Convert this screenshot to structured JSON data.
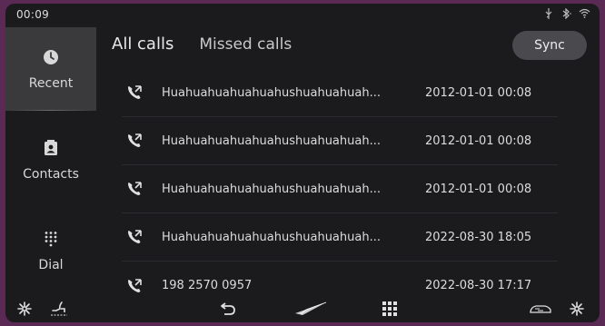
{
  "status": {
    "time": "00:09",
    "icons": [
      "usb-icon",
      "bluetooth-icon",
      "wifi-icon"
    ]
  },
  "sidebar": {
    "items": [
      {
        "label": "Recent",
        "icon": "clock-icon",
        "active": true
      },
      {
        "label": "Contacts",
        "icon": "contact-card-icon",
        "active": false
      },
      {
        "label": "Dial",
        "icon": "dialpad-icon",
        "active": false
      }
    ]
  },
  "tabs": [
    {
      "label": "All calls",
      "active": true
    },
    {
      "label": "Missed calls",
      "active": false
    }
  ],
  "sync_label": "Sync",
  "calls": [
    {
      "name": "Huahuahuahuahuahushuahuahuah...",
      "time": "2012-01-01 00:08"
    },
    {
      "name": "Huahuahuahuahuahushuahuahuah...",
      "time": "2012-01-01 00:08"
    },
    {
      "name": "Huahuahuahuahuahushuahuahuah...",
      "time": "2012-01-01 00:08"
    },
    {
      "name": "Huahuahuahuahuahushuahuahuah...",
      "time": "2022-08-30 18:05"
    },
    {
      "name": "198 2570 0957",
      "time": "2022-08-30 17:17"
    }
  ],
  "bottom": {
    "icons": [
      "fan-icon",
      "seat-heat-icon",
      "back-icon",
      "brand-logo-icon",
      "apps-grid-icon",
      "car-air-icon",
      "fan-icon"
    ]
  },
  "colors": {
    "background": "#1b1b1d",
    "active_item": "#3a3a3d",
    "button": "#4a4a4e",
    "border": "#5a2a55"
  }
}
